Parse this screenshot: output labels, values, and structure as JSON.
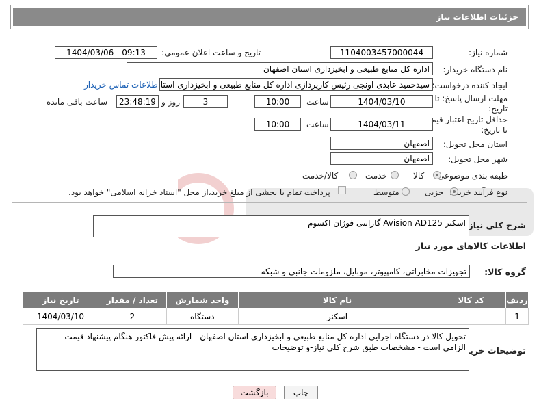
{
  "header": {
    "title": "جزئیات اطلاعات نیاز"
  },
  "form": {
    "need_number": {
      "label": "شماره نیاز:",
      "value": "1104003457000044"
    },
    "announce_datetime": {
      "label": "تاریخ و ساعت اعلان عمومی:",
      "value": "1404/03/06 - 09:13"
    },
    "buyer_org": {
      "label": "نام دستگاه خریدار:",
      "value": "اداره کل منابع طبیعی و ابخیزداری استان اصفهان"
    },
    "requester": {
      "label": "ایجاد کننده درخواست:",
      "value": "سیدحمید عابدی اونجی رئیس کارپردازی اداره کل منابع طبیعی و ابخیزداری استا",
      "contact_link": "اطلاعات تماس خریدار"
    },
    "reply_deadline": {
      "label_line1": "مهلت ارسال پاسخ: تا",
      "label_line2": "تاریخ:",
      "date": "1404/03/10",
      "time_label": "ساعت",
      "time": "10:00",
      "days": "3",
      "days_label": "روز و",
      "remaining": "23:48:19",
      "remaining_label": "ساعت باقی مانده"
    },
    "price_validity": {
      "label_line1": "حداقل تاریخ اعتبار قیمت:",
      "label_line2": "تا تاریخ:",
      "date": "1404/03/11",
      "time_label": "ساعت",
      "time": "10:00"
    },
    "delivery_province": {
      "label": "استان محل تحویل:",
      "value": "اصفهان"
    },
    "delivery_city": {
      "label": "شهر محل تحویل:",
      "value": "اصفهان"
    },
    "category": {
      "label": "طبقه بندی موضوعی:",
      "options": [
        "کالا",
        "خدمت",
        "کالا/خدمت"
      ],
      "selected": "کالا"
    },
    "process_type": {
      "label": "نوع فرآیند خرید :",
      "options": [
        "جزیی",
        "متوسط"
      ],
      "selected": "جزیی",
      "payment_note": "پرداخت تمام یا بخشی از مبلغ خرید،از محل \"اسناد خزانه اسلامی\" خواهد بود."
    }
  },
  "general_description": {
    "label": "شرح کلی نیاز:",
    "value": "اسکنر Avision AD125 گارانتی فوژان اکسوم"
  },
  "goods_info": {
    "title": "اطلاعات کالاهای مورد نیاز",
    "group_label": "گروه کالا:",
    "group_value": "تجهیزات مخابراتی، کامپیوتر، موبایل، ملزومات جانبی و شبکه",
    "table": {
      "headers": [
        "ردیف",
        "کد کالا",
        "نام کالا",
        "واحد شمارش",
        "تعداد / مقدار",
        "تاریخ نیاز"
      ],
      "rows": [
        [
          "1",
          "--",
          "اسکنر",
          "دستگاه",
          "2",
          "1404/03/10"
        ]
      ]
    }
  },
  "buyer_notes": {
    "label": "توضیحات خریدار:",
    "value": "تحویل کالا در دستگاه اجرایی اداره کل منابع طبیعی و ابخیزداری استان اصفهان - ارائه پیش فاکتور هنگام پیشنهاد قیمت الزامی است - مشخصات طبق شرح کلی نیاز-و توضیحات"
  },
  "buttons": {
    "print": "چاپ",
    "back": "بازگشت"
  },
  "colors": {
    "header_bg": "#8a8a8a",
    "table_header_bg": "#7c7c7c",
    "link": "#1a5fb4",
    "back_button_bg": "#f8dcdc"
  }
}
